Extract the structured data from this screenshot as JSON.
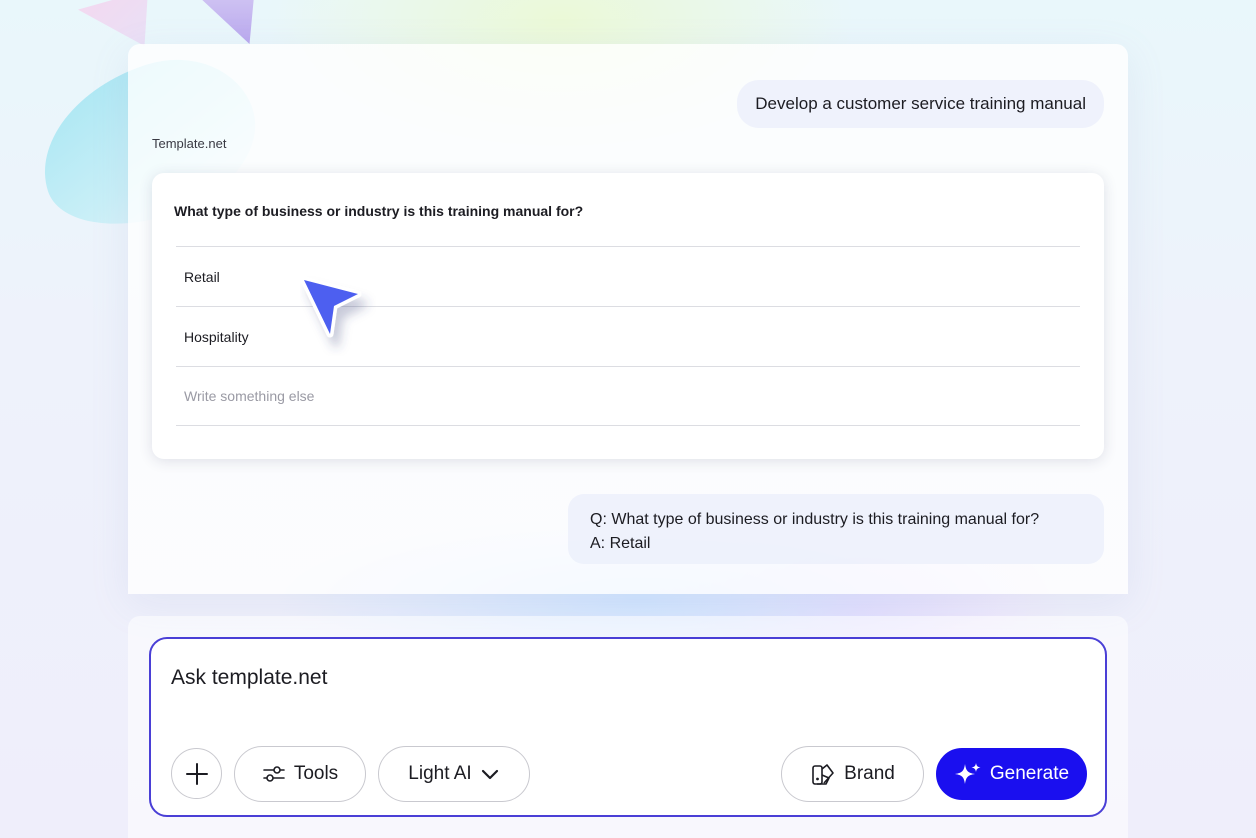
{
  "chat": {
    "user_message": "Develop a customer service training manual",
    "source_label": "Template.net",
    "question": {
      "title": "What type of business or industry is this training manual for?",
      "options": [
        "Retail",
        "Hospitality"
      ],
      "custom_placeholder": "Write something else"
    },
    "answer": {
      "q_line": "Q: What type of business or industry is this training manual for?",
      "a_line": "A: Retail"
    }
  },
  "composer": {
    "placeholder": "Ask template.net",
    "tools_label": "Tools",
    "model_label": "Light AI",
    "brand_label": "Brand",
    "generate_label": "Generate"
  },
  "icons": {
    "add": "plus-icon",
    "tools": "sliders-icon",
    "model_dropdown": "chevron-down-icon",
    "brand": "palette-icon",
    "generate": "sparkle-icon",
    "cursor": "cursor-arrow-icon"
  },
  "colors": {
    "accent": "#1a0fef",
    "composer_border": "#4a3fd6",
    "cursor": "#4d5ff0"
  }
}
